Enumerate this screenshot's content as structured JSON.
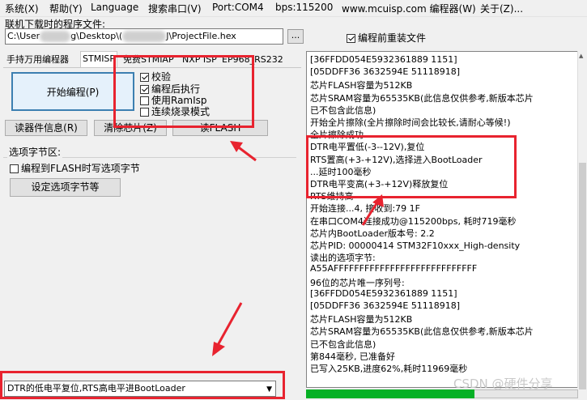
{
  "menu": [
    "系统(X)",
    "帮助(Y)",
    "Language",
    "搜索串口(V)",
    "Port:COM4",
    "bps:115200",
    "www.mcuisp.com 编程器(W)",
    "关于(Z)..."
  ],
  "file_label": "联机下载时的程序文件:",
  "file_path_start": "C:\\User",
  "file_path_mid": "g\\Desktop\\(",
  "file_path_end": "J\\ProjectFile.hex",
  "browse_label": "...",
  "reload_label": "编程前重装文件",
  "tabs": [
    "手持万用编程器",
    "STMISP",
    "免费STMIAP",
    "NXP ISP",
    "EP968_RS232"
  ],
  "start_button": "开始编程(P)",
  "options": {
    "verify": "校验",
    "run_after": "编程后执行",
    "use_ramisp": "使用RamIsp",
    "continuous": "连续烧录模式"
  },
  "read_info_button": "读器件信息(R)",
  "erase_button": "清除芯片(Z)",
  "read_flash_button": "读FLASH",
  "option_group_title": "选项字节区:",
  "option_program_label": "编程到FLASH时写选项字节",
  "option_set_button": "设定选项字节等",
  "boot_select": "DTR的低电平复位,RTS高电平进BootLoader",
  "log_lines": [
    "[36FFDD054E5932361889 1151]",
    "[05DDFF36 3632594E 51118918]",
    "芯片FLASH容量为512KB",
    "芯片SRAM容量为65535KB(此信息仅供参考,新版本芯片",
    "已不包含此信息)",
    "开始全片擦除(全片擦除时间会比较长,请耐心等候!)",
    "全片擦除成功",
    "DTR电平置低(-3--12V),复位",
    "RTS置高(+3-+12V),选择进入BootLoader",
    "...延时100毫秒",
    "DTR电平变高(+3-+12V)释放复位",
    "RTS维持高",
    "开始连接...4, 接收到:79 1F",
    "在串口COM4连接成功@115200bps, 耗时719毫秒",
    "芯片内BootLoader版本号: 2.2",
    "芯片PID:  00000414   STM32F10xxx_High-density",
    "读出的选项字节:",
    "A55AFFFFFFFFFFFFFFFFFFFFFFFFFFFF",
    "96位的芯片唯一序列号:",
    "[36FFDD054E5932361889 1151]",
    "[05DDFF36 3632594E 51118918]",
    "芯片FLASH容量为512KB",
    "芯片SRAM容量为65535KB(此信息仅供参考,新版本芯片",
    "已不包含此信息)",
    "第844毫秒, 已准备好",
    "已写入25KB,进度62%,耗时11969毫秒"
  ],
  "progress_percent": 62,
  "watermark": "CSDN @硬件分享",
  "colors": {
    "highlight": "#e8232f",
    "progress": "#06b025"
  }
}
